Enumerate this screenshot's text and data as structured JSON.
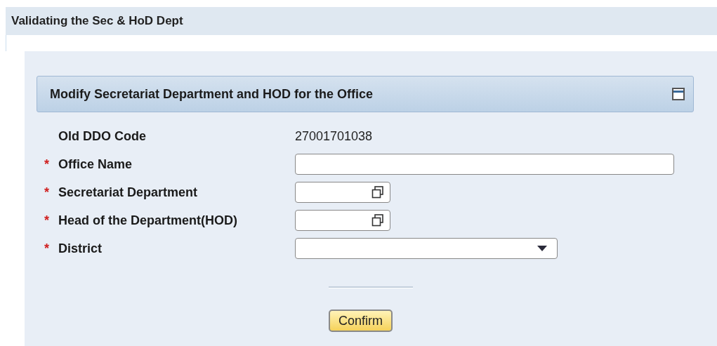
{
  "page_title": "Validating the Sec & HoD Dept",
  "panel": {
    "title": "Modify Secretariat Department and HOD for the Office",
    "expanded": true
  },
  "fields": [
    {
      "kind": "display",
      "label": "Old DDO Code",
      "value": "27001701038"
    },
    {
      "kind": "text",
      "mark": "*",
      "label": "Office Name"
    },
    {
      "kind": "lookup",
      "mark": "*",
      "label": "Secretariat Department"
    },
    {
      "kind": "lookup",
      "mark": "*",
      "label": "Head of the Department(HOD)"
    },
    {
      "kind": "dropdown",
      "mark": "*",
      "label": "District"
    }
  ],
  "buttons": [
    "Confirm"
  ]
}
